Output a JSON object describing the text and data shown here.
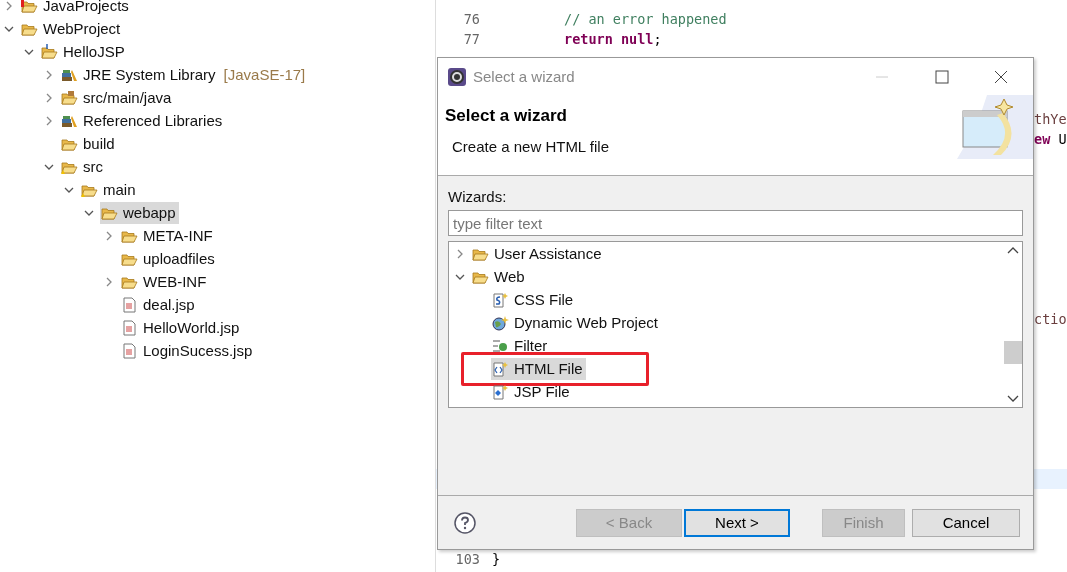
{
  "explorer": {
    "items": [
      {
        "label": "JavaProjects",
        "kind": "errorproject",
        "expanded": false,
        "selected": false
      },
      {
        "label": "WebProject",
        "kind": "workset",
        "expanded": true,
        "selected": false,
        "children": [
          {
            "label": "HelloJSP",
            "kind": "webproject",
            "expanded": true,
            "selected": false,
            "children": [
              {
                "label": "JRE System Library",
                "decoration": "[JavaSE-17]",
                "kind": "library",
                "expanded": false,
                "selected": false
              },
              {
                "label": "src/main/java",
                "kind": "package",
                "expanded": false,
                "selected": false
              },
              {
                "label": "Referenced Libraries",
                "kind": "library",
                "expanded": false,
                "selected": false
              },
              {
                "label": "build",
                "kind": "folder",
                "selected": false
              },
              {
                "label": "src",
                "kind": "sourcefolder",
                "expanded": true,
                "selected": false,
                "children": [
                  {
                    "label": "main",
                    "kind": "sourcefolder",
                    "expanded": true,
                    "selected": false,
                    "children": [
                      {
                        "label": "webapp",
                        "kind": "folder",
                        "expanded": true,
                        "selected": true,
                        "children": [
                          {
                            "label": "META-INF",
                            "kind": "folder",
                            "expanded": false,
                            "selected": false
                          },
                          {
                            "label": "uploadfiles",
                            "kind": "folder",
                            "selected": false
                          },
                          {
                            "label": "WEB-INF",
                            "kind": "folder",
                            "expanded": false,
                            "selected": false
                          },
                          {
                            "label": "deal.jsp",
                            "kind": "jsp",
                            "selected": false
                          },
                          {
                            "label": "HelloWorld.jsp",
                            "kind": "jsp",
                            "selected": false
                          },
                          {
                            "label": "LoginSucess.jsp",
                            "kind": "jsp",
                            "selected": false
                          }
                        ]
                      }
                    ]
                  }
                ]
              }
            ]
          }
        ]
      }
    ]
  },
  "editor": {
    "lines": [
      {
        "number": "76",
        "segments": [
          {
            "text": "// an error happened",
            "kind": "comment"
          }
        ],
        "current": false
      },
      {
        "number": "77",
        "segments": [
          {
            "text": "return null",
            "kind": "keyword"
          },
          {
            "text": ";",
            "kind": "plain"
          }
        ],
        "current": false
      },
      {
        "segments": [
          {
            "text": "thYe",
            "kind": "variable"
          }
        ],
        "current": false
      },
      {
        "segments": [
          {
            "text": "ew",
            "kind": "keyword"
          },
          {
            "text": " U",
            "kind": "plain"
          }
        ],
        "current": false
      },
      {
        "segments": [
          {
            "text": "ctio",
            "kind": "variable"
          }
        ],
        "current": false
      },
      {
        "current": true
      },
      {
        "number": "103",
        "segments": [
          {
            "text": "}",
            "kind": "plain"
          }
        ],
        "current": false
      }
    ]
  },
  "dialog": {
    "title": "Select a wizard",
    "heading": "Select a wizard",
    "description": "Create a new HTML file",
    "list_label": "Wizards:",
    "filter": {
      "placeholder": "type filter text"
    },
    "wizards": [
      {
        "label": "User Assistance",
        "kind": "folder",
        "expanded": false,
        "selected": false
      },
      {
        "label": "Web",
        "kind": "folder",
        "expanded": true,
        "selected": false,
        "children": [
          {
            "label": "CSS File",
            "kind": "css",
            "selected": false
          },
          {
            "label": "Dynamic Web Project",
            "kind": "project",
            "selected": false
          },
          {
            "label": "Filter",
            "kind": "filter",
            "selected": false
          },
          {
            "label": "HTML File",
            "kind": "html",
            "selected": true,
            "marked": true
          },
          {
            "label": "JSP File",
            "kind": "jsp",
            "selected": false
          }
        ]
      }
    ],
    "buttons": [
      {
        "label": "< Back",
        "disabled": true,
        "default": false
      },
      {
        "label": "Next >",
        "disabled": false,
        "default": true
      },
      {
        "label": "Finish",
        "disabled": true,
        "default": false
      },
      {
        "label": "Cancel",
        "disabled": false,
        "default": false
      }
    ]
  }
}
